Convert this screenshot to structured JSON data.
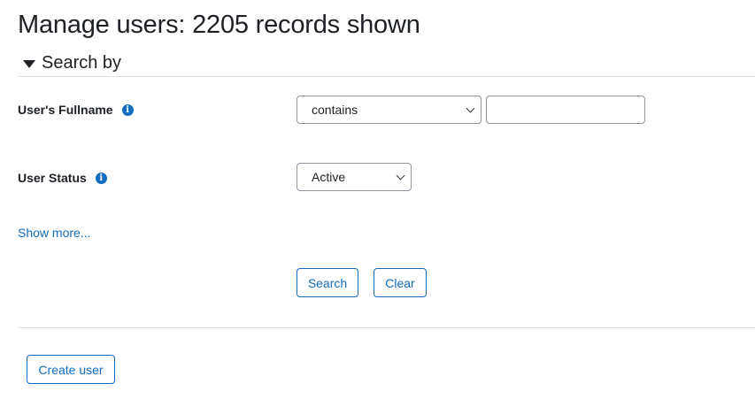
{
  "page_title": "Manage users: 2205 records shown",
  "search_section": {
    "title": "Search by",
    "caret_icon": "caret-down-icon",
    "fields": {
      "fullname": {
        "label": "User's Fullname",
        "info_icon": "i",
        "operator_selected": "contains",
        "value": ""
      },
      "status": {
        "label": "User Status",
        "info_icon": "i",
        "selected": "Active"
      }
    },
    "show_more_label": "Show more...",
    "search_label": "Search",
    "clear_label": "Clear"
  },
  "create_user_label": "Create user",
  "colors": {
    "accent": "#0f6cbf",
    "text": "#1d2125",
    "border": "#8f959e",
    "divider": "#dee2e6"
  }
}
